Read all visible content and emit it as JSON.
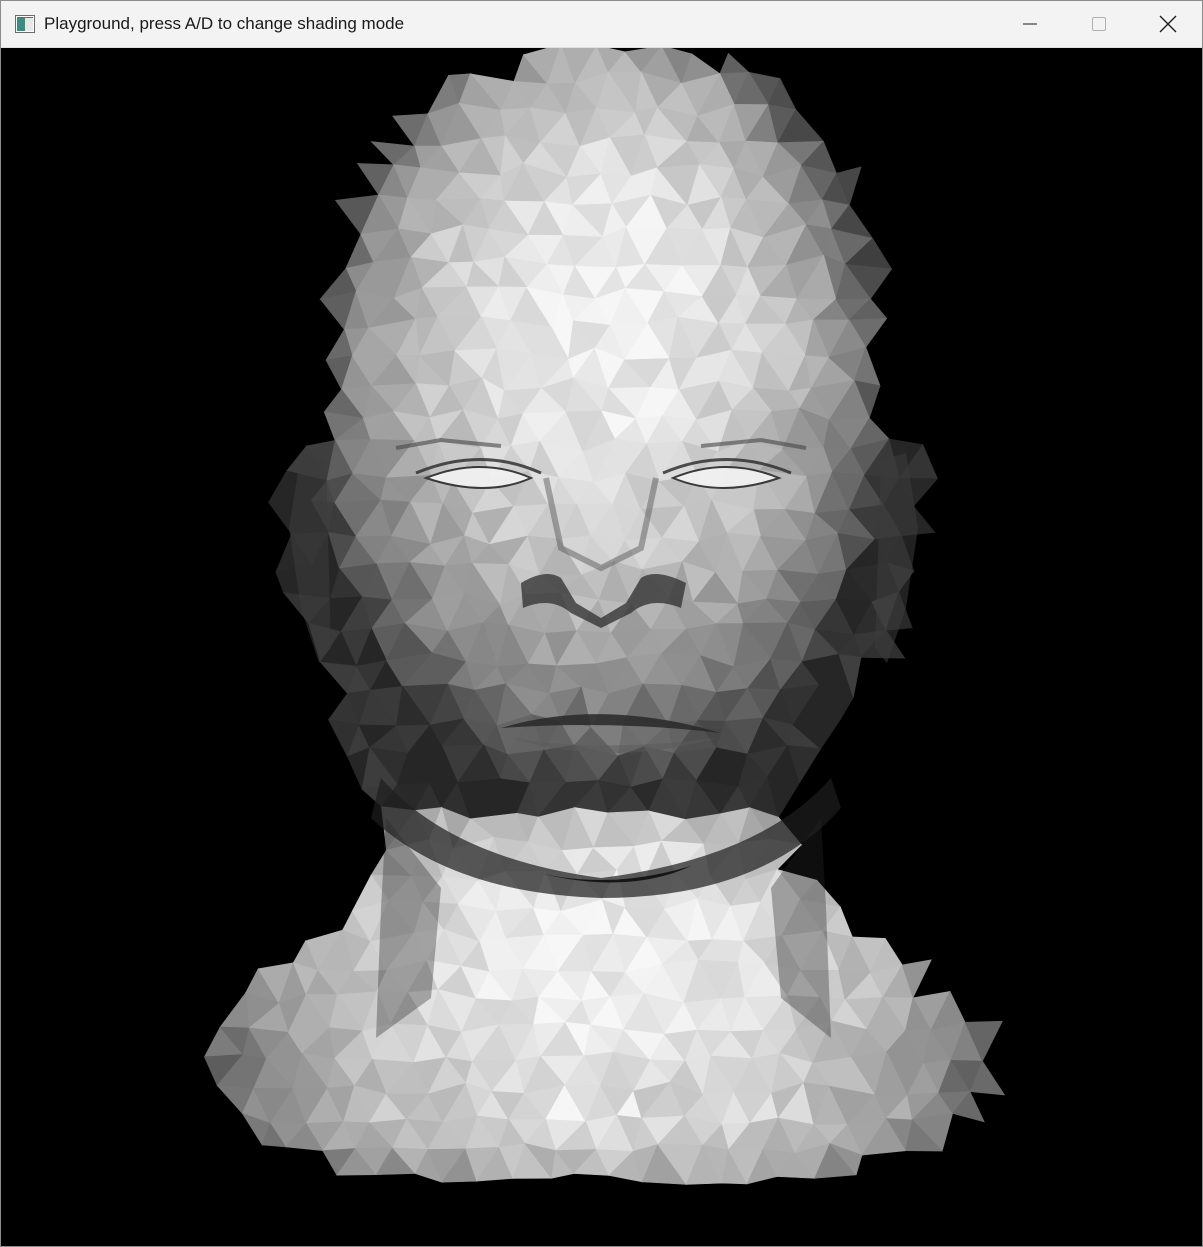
{
  "window": {
    "title": "Playground, press A/D to change shading mode"
  },
  "titlebar_controls": {
    "minimize_icon": "minimize-icon",
    "maximize_icon": "maximize-icon",
    "close_icon": "close-icon"
  },
  "viewport": {
    "background": "#000000",
    "content": "flat-shaded-head-mesh"
  }
}
